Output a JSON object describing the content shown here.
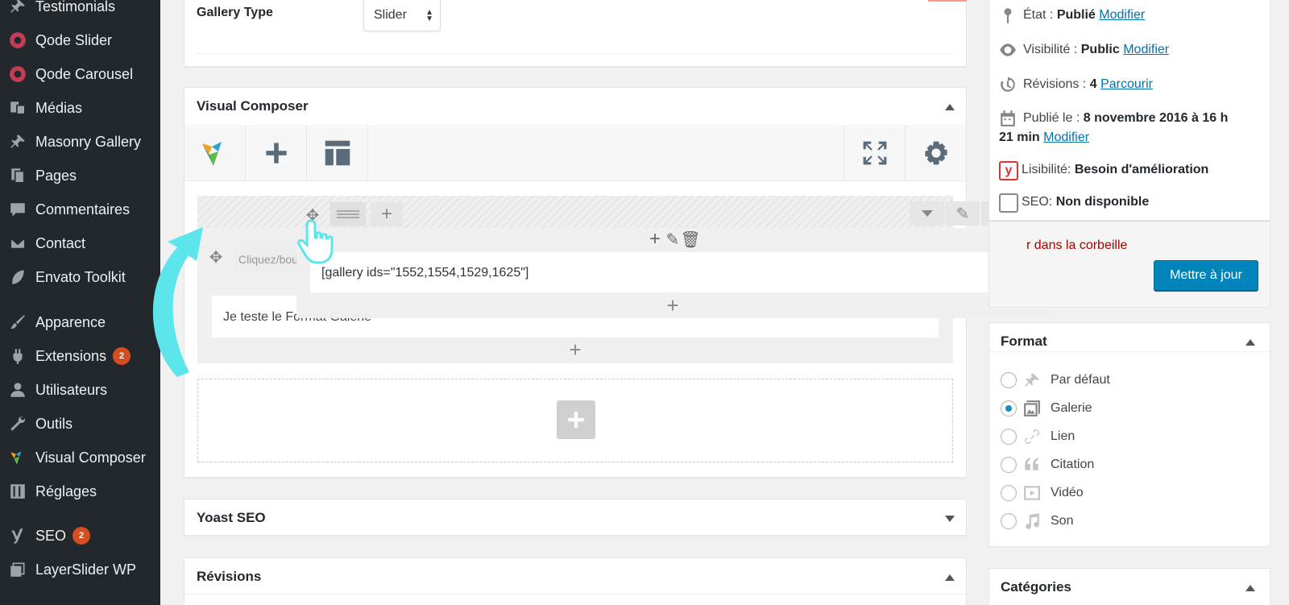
{
  "sidebar": {
    "items": [
      {
        "label": "Testimonials",
        "icon": "pin-icon"
      },
      {
        "label": "Qode Slider",
        "icon": "qode-slider-icon"
      },
      {
        "label": "Qode Carousel",
        "icon": "qode-carousel-icon"
      },
      {
        "label": "Médias",
        "icon": "media-icon"
      },
      {
        "label": "Masonry Gallery",
        "icon": "pin-icon"
      },
      {
        "label": "Pages",
        "icon": "pages-icon"
      },
      {
        "label": "Commentaires",
        "icon": "comments-icon"
      },
      {
        "label": "Contact",
        "icon": "mail-icon"
      },
      {
        "label": "Envato Toolkit",
        "icon": "leaf-icon"
      },
      {
        "label": "Apparence",
        "icon": "brush-icon"
      },
      {
        "label": "Extensions",
        "icon": "plugin-icon",
        "badge": "2"
      },
      {
        "label": "Utilisateurs",
        "icon": "user-icon"
      },
      {
        "label": "Outils",
        "icon": "wrench-icon"
      },
      {
        "label": "Visual Composer",
        "icon": "vc-logo-icon"
      },
      {
        "label": "Réglages",
        "icon": "settings-sliders-icon"
      },
      {
        "label": "SEO",
        "icon": "yoast-icon",
        "badge": "2"
      },
      {
        "label": "LayerSlider WP",
        "icon": "layers-icon"
      }
    ]
  },
  "gallery_type": {
    "label": "Gallery Type",
    "value": "Slider"
  },
  "visual_composer": {
    "title": "Visual Composer",
    "shortcode": "[gallery ids=\"1552,1554,1529,1625\"]",
    "text_block": "Je teste le Format Galerie",
    "drag_tooltip": "Cliquez/bougez pour réordonner"
  },
  "yoast": {
    "title": "Yoast SEO"
  },
  "revisions": {
    "title": "Révisions"
  },
  "publish": {
    "state_label": "État :",
    "state_value": "Publié",
    "visibility_label": "Visibilité :",
    "visibility_value": "Public",
    "revisions_label": "Révisions :",
    "revisions_value": "4",
    "browse": "Parcourir",
    "published_label": "Publié le :",
    "published_value_1": "8 novembre 2016 à 16 h",
    "published_value_2": "21 min",
    "modify": "Modifier",
    "readability_label": "Lisibilité:",
    "readability_value": "Besoin d'amélioration",
    "seo_label": "SEO:",
    "seo_value": "Non disponible",
    "trash": "r dans la corbeille",
    "update": "Mettre à jour"
  },
  "format": {
    "title": "Format",
    "options": [
      {
        "label": "Par défaut",
        "icon": "pin-icon",
        "checked": false
      },
      {
        "label": "Galerie",
        "icon": "gallery-icon",
        "checked": true
      },
      {
        "label": "Lien",
        "icon": "link-icon",
        "checked": false
      },
      {
        "label": "Citation",
        "icon": "quote-icon",
        "checked": false
      },
      {
        "label": "Vidéo",
        "icon": "video-icon",
        "checked": false
      },
      {
        "label": "Son",
        "icon": "audio-icon",
        "checked": false
      }
    ]
  },
  "categories": {
    "title": "Catégories"
  },
  "colors": {
    "sidebar": "#23282d",
    "primary": "#0085ba",
    "link": "#0073aa",
    "badge": "#d54e21",
    "annotation_arrow": "#5ce6ec"
  }
}
